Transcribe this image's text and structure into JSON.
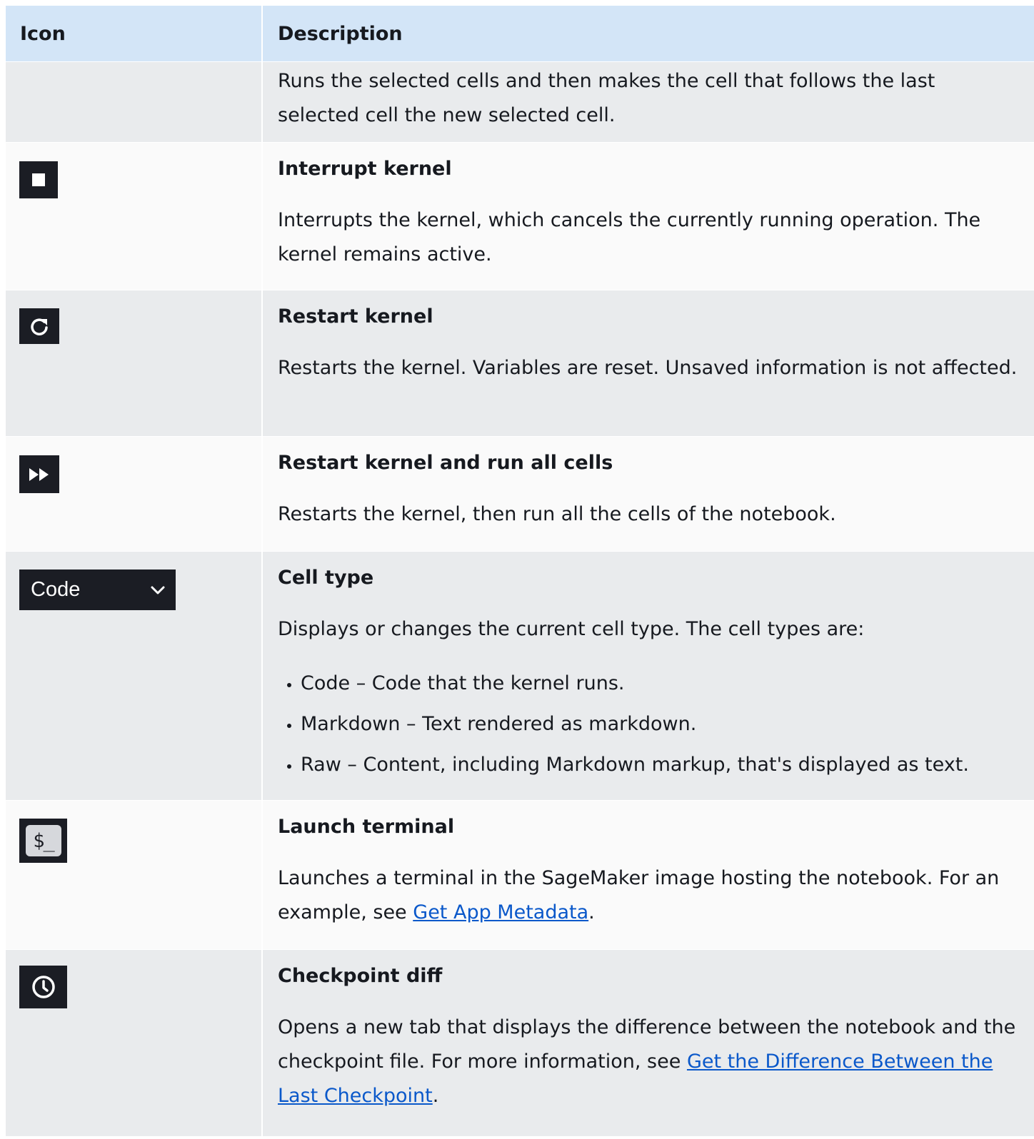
{
  "header": {
    "icon_col": "Icon",
    "desc_col": "Description"
  },
  "rows": [
    {
      "text": "Runs the selected cells and then makes the cell that follows the last selected cell the new selected cell."
    },
    {
      "icon": "stop-icon",
      "title": "Interrupt kernel",
      "text": "Interrupts the kernel, which cancels the currently running operation. The kernel remains active."
    },
    {
      "icon": "refresh-icon",
      "title": "Restart kernel",
      "text": "Restarts the kernel. Variables are reset. Unsaved information is not affected."
    },
    {
      "icon": "fast-forward-icon",
      "title": "Restart kernel and run all cells",
      "text": "Restarts the kernel, then run all the cells of the notebook."
    },
    {
      "icon": "cell-type-dropdown",
      "select_value": "Code",
      "title": "Cell type",
      "text": "Displays or changes the current cell type. The cell types are:",
      "items": [
        "Code – Code that the kernel runs.",
        "Markdown – Text rendered as markdown.",
        "Raw – Content, including Markdown markup, that's displayed as text."
      ]
    },
    {
      "icon": "terminal-icon",
      "icon_text": "$_",
      "title": "Launch terminal",
      "text_before": "Launches a terminal in the SageMaker image hosting the notebook. For an example, see ",
      "link": "Get App Metadata",
      "text_after": "."
    },
    {
      "icon": "clock-icon",
      "title": "Checkpoint diff",
      "text_before": "Opens a new tab that displays the difference between the notebook and the checkpoint file. For more information, see ",
      "link": "Get the Difference Between the Last Checkpoint",
      "text_after": "."
    }
  ]
}
